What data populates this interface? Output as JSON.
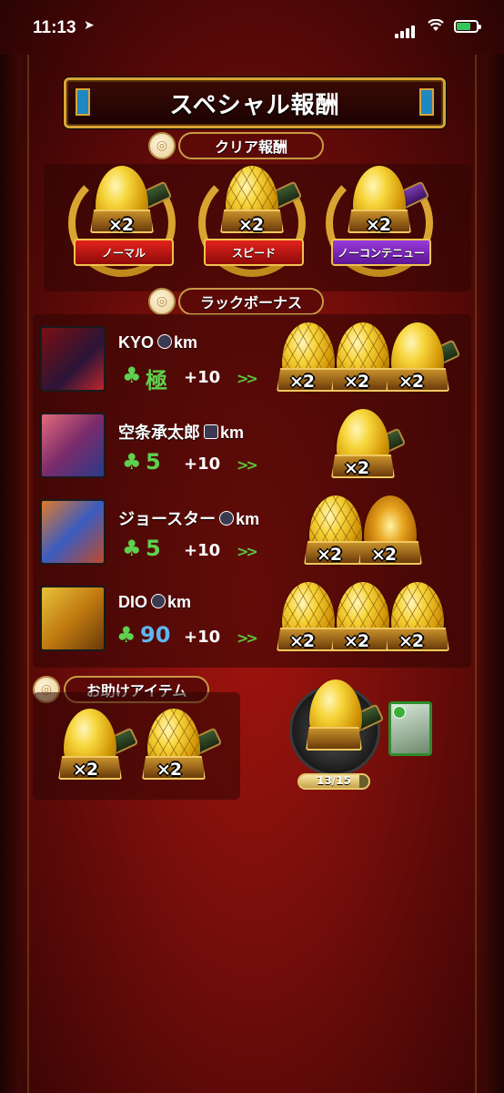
{
  "status_bar": {
    "time": "11:13",
    "battery_level": 0.7
  },
  "title": "スペシャル報酬",
  "clear_reward": {
    "header": "クリア報酬",
    "items": [
      {
        "count": "×2",
        "label": "ノーマル",
        "ribbon_color": "#c8140f"
      },
      {
        "count": "×2",
        "label": "スピード",
        "ribbon_color": "#c8140f"
      },
      {
        "count": "×2",
        "label": "ノーコンテニュー",
        "ribbon_color": "#7b27b8"
      }
    ]
  },
  "luck_bonus": {
    "header": "ラックボーナス",
    "players": [
      {
        "name": "KYO",
        "unit": "km",
        "luck": "極",
        "bonus": "+10",
        "rewards": [
          "×2",
          "×2",
          "×2"
        ]
      },
      {
        "name": "空条承太郎",
        "unit": "km",
        "luck": "5",
        "bonus": "+10",
        "rewards": [
          "×2"
        ]
      },
      {
        "name": "ジョースター",
        "unit": "km",
        "luck": "5",
        "bonus": "+10",
        "rewards": [
          "×2",
          "×2"
        ]
      },
      {
        "name": "DIO",
        "unit": "km",
        "luck": "90",
        "bonus": "+10",
        "rewards": [
          "×2",
          "×2",
          "×2"
        ]
      }
    ]
  },
  "help_items": {
    "header": "お助けアイテム",
    "items": [
      "×2",
      "×2"
    ]
  },
  "progress": {
    "label": "13/15",
    "current": 13,
    "total": 15
  },
  "colors": {
    "background": "#8a110c",
    "gold": "#d8a536",
    "clover": "#5dd24e"
  }
}
